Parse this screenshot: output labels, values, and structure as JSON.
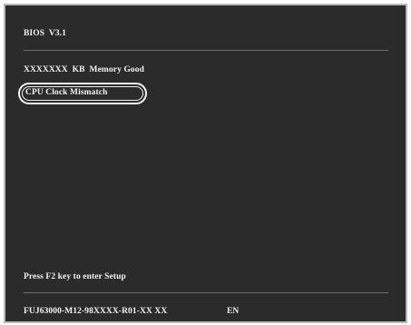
{
  "bios": {
    "title": "BIOS  V3.1",
    "memory_line": "XXXXXXX  KB  Memory Good",
    "error_line": "CPU Clock Mismatch",
    "prompt": "Press F2 key to enter Setup",
    "footer": "FUJ63000-M12-98XXXX-R01-XX XX",
    "language": "EN"
  },
  "colors": {
    "screen_background": "#2b2b2b",
    "text": "#f2f2f2",
    "divider": "#6e6e6e",
    "frame_border": "#b9b9b9"
  }
}
